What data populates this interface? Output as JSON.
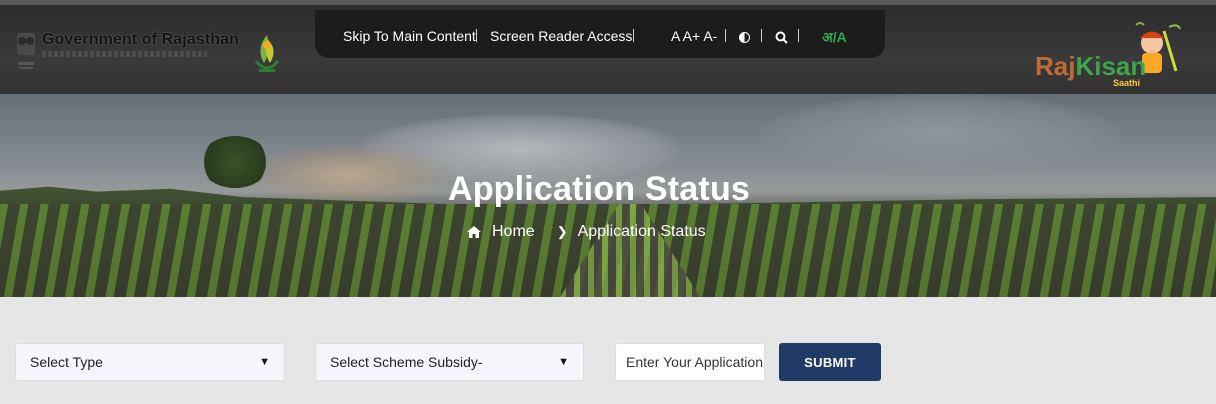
{
  "header": {
    "gov_title": "Government of Rajasthan",
    "nav": {
      "skip_link": "Skip To Main Content",
      "screen_reader": "Screen Reader Access",
      "font_sizes": "A A+ A-",
      "contrast_icon": "contrast-icon",
      "search_icon": "search-icon",
      "language": "अ/A"
    },
    "brand": {
      "raj": "Raj",
      "kisan": "Kisan",
      "saathi": "Saathi"
    }
  },
  "banner": {
    "title": "Application Status",
    "breadcrumb": {
      "home": "Home",
      "current": "Application Status"
    }
  },
  "form": {
    "type_select": "Select Type",
    "scheme_select": "Select Scheme Subsidy-",
    "application_input_placeholder": "Enter Your Application",
    "submit_label": "SUBMIT"
  },
  "colors": {
    "submit_bg": "#1f3a66",
    "language_green": "#2aa84a",
    "brand_orange": "#c06a34",
    "brand_green": "#3ea34a"
  }
}
